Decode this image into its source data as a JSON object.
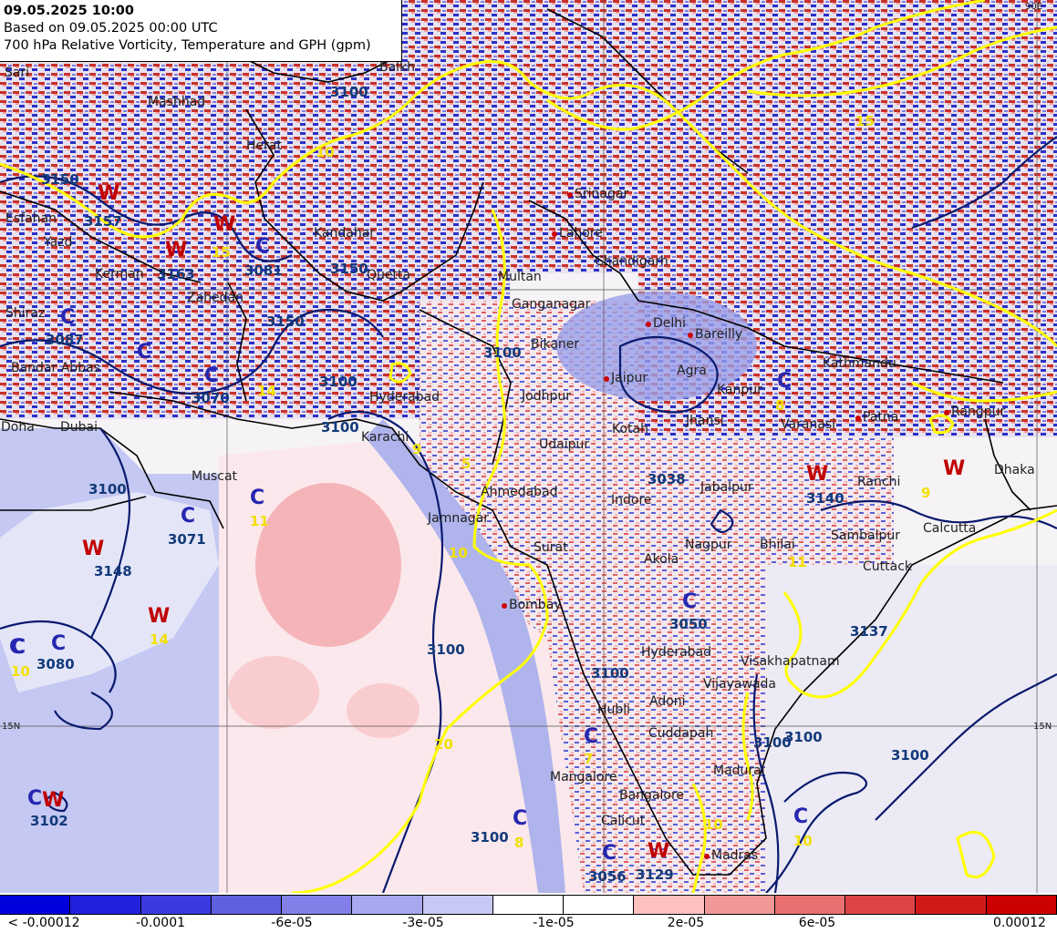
{
  "header": {
    "line1": "09.05.2025 10:00",
    "line2": "Based on 09.05.2025 00:00 UTC",
    "line3": "700 hPa Relative Vorticity, Temperature and GPH (gpm)"
  },
  "colors": {
    "land_bg": "#f6f3f6",
    "gph_contour": "#0a1a6e",
    "temp_contour": "#ffff00",
    "border": "#000000",
    "cyclone": "#2626b0",
    "warm": "#c00000"
  },
  "cities": [
    {
      "name": "Sari"
    },
    {
      "name": "Mashhad"
    },
    {
      "name": "Balkh"
    },
    {
      "name": "Herat"
    },
    {
      "name": "Esfahan"
    },
    {
      "name": "Yazd"
    },
    {
      "name": "Kerman"
    },
    {
      "name": "Kandahar"
    },
    {
      "name": "Quetta"
    },
    {
      "name": "Zahedan"
    },
    {
      "name": "Shiraz"
    },
    {
      "name": "Bandar Abbas"
    },
    {
      "name": "Doha"
    },
    {
      "name": "Dubai"
    },
    {
      "name": "Muscat"
    },
    {
      "name": "Karachi"
    },
    {
      "name": "Hyderabad"
    },
    {
      "name": "Multan"
    },
    {
      "name": "Lahore"
    },
    {
      "name": "Srinagar"
    },
    {
      "name": "Chandigarh"
    },
    {
      "name": "Ganganagar"
    },
    {
      "name": "Delhi"
    },
    {
      "name": "Bareilly"
    },
    {
      "name": "Bikaner"
    },
    {
      "name": "Jaipur"
    },
    {
      "name": "Agra"
    },
    {
      "name": "Jodhpur"
    },
    {
      "name": "Kanpur"
    },
    {
      "name": "Kotah"
    },
    {
      "name": "Jhansi"
    },
    {
      "name": "Varanasi"
    },
    {
      "name": "Patna"
    },
    {
      "name": "Kathmandu"
    },
    {
      "name": "Rangpur"
    },
    {
      "name": "Udaipur"
    },
    {
      "name": "Ahmedabad"
    },
    {
      "name": "Indore"
    },
    {
      "name": "Jabalpur"
    },
    {
      "name": "Ranchi"
    },
    {
      "name": "Dhaka"
    },
    {
      "name": "Jamnagar"
    },
    {
      "name": "Surat"
    },
    {
      "name": "Akola"
    },
    {
      "name": "Nagpur"
    },
    {
      "name": "Bhilai"
    },
    {
      "name": "Sambalpur"
    },
    {
      "name": "Calcutta"
    },
    {
      "name": "Cuttack"
    },
    {
      "name": "Bombay"
    },
    {
      "name": "Hyderabad"
    },
    {
      "name": "Visakhapatnam"
    },
    {
      "name": "Vijayawada"
    },
    {
      "name": "Hubli"
    },
    {
      "name": "Adoni"
    },
    {
      "name": "Cuddapah"
    },
    {
      "name": "Madras"
    },
    {
      "name": "Mangalore"
    },
    {
      "name": "Bangalore"
    },
    {
      "name": "Calicut"
    },
    {
      "name": "Madurai"
    }
  ],
  "systems": [
    {
      "type": "W"
    },
    {
      "type": "W"
    },
    {
      "type": "W"
    },
    {
      "type": "C"
    },
    {
      "type": "C"
    },
    {
      "type": "C"
    },
    {
      "type": "C"
    },
    {
      "type": "W"
    },
    {
      "type": "W"
    },
    {
      "type": "C"
    },
    {
      "type": "C"
    },
    {
      "type": "C"
    },
    {
      "type": "C"
    },
    {
      "type": "W"
    },
    {
      "type": "C"
    },
    {
      "type": "C"
    },
    {
      "type": "C"
    },
    {
      "type": "C"
    },
    {
      "type": "W"
    },
    {
      "type": "C"
    },
    {
      "type": "C"
    },
    {
      "type": "W"
    },
    {
      "type": "W"
    },
    {
      "type": "C"
    },
    {
      "type": "C"
    }
  ],
  "gph_values": [
    "3150",
    "3157",
    "3163",
    "3081",
    "3150",
    "3150",
    "3087",
    "3070",
    "3100",
    "3100",
    "3100",
    "3071",
    "3148",
    "3080",
    "3038",
    "3140",
    "3050",
    "3137",
    "3100",
    "3100",
    "3100",
    "3102",
    "3056",
    "3129",
    "3100",
    "3100",
    "3100",
    "3100",
    "3100"
  ],
  "temp_values": [
    "10",
    "15",
    "14",
    "9",
    "11",
    "14",
    "10",
    "5",
    "15",
    "20",
    "10",
    "11",
    "8",
    "8",
    "7",
    "9",
    "10",
    "10"
  ],
  "grid_labels": [
    "90E",
    "15N",
    "15N"
  ],
  "colorbar": {
    "colors": [
      "#0000dd",
      "#2020dd",
      "#3a3ae0",
      "#5f5fe0",
      "#8080e8",
      "#a8a8f0",
      "#c8c8f6",
      "#ffffff",
      "#ffffff",
      "#ffc0c0",
      "#f09898",
      "#e87070",
      "#dd4545",
      "#d01a1a",
      "#cc0000"
    ],
    "labels": [
      "< -0.00012",
      "-0.0001",
      "-6e-05",
      "-3e-05",
      "-1e-05",
      "2e-05",
      "6e-05",
      "0.00012"
    ]
  }
}
